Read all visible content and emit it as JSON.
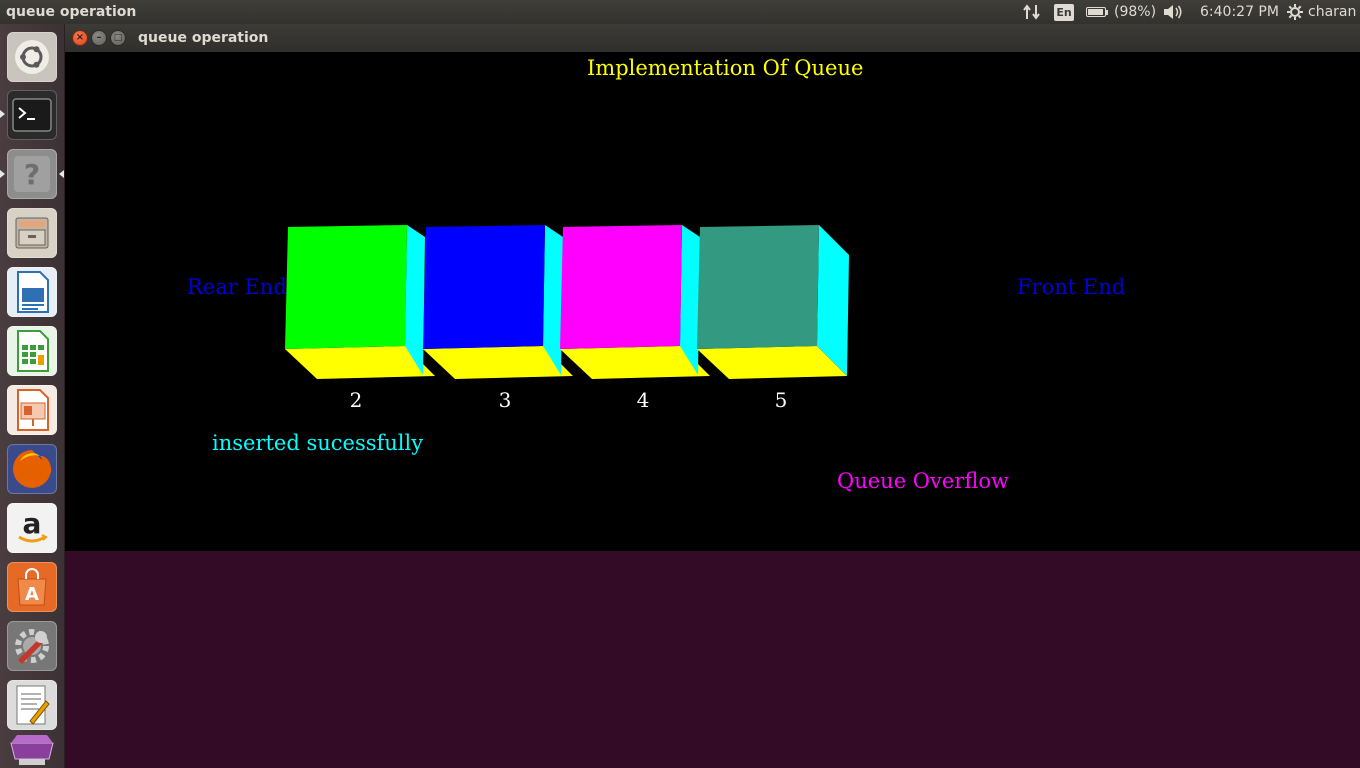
{
  "top_panel": {
    "app_title": "queue operation",
    "keyboard_layout": "En",
    "battery": "(98%)",
    "battery_level": 0.98,
    "time": "6:40:27 PM",
    "user": "charan",
    "icons": [
      "network-transfer-icon",
      "keyboard-layout-icon",
      "battery-icon",
      "volume-icon",
      "settings-gear-icon"
    ]
  },
  "launcher": {
    "items": [
      {
        "name": "ubuntu-dash",
        "icon": "ubuntu-logo-icon"
      },
      {
        "name": "terminal",
        "icon": "terminal-icon"
      },
      {
        "name": "help",
        "icon": "help-icon"
      },
      {
        "name": "files",
        "icon": "file-cabinet-icon"
      },
      {
        "name": "libreoffice-writer",
        "icon": "writer-icon"
      },
      {
        "name": "libreoffice-calc",
        "icon": "calc-icon"
      },
      {
        "name": "libreoffice-impress",
        "icon": "impress-icon"
      },
      {
        "name": "firefox",
        "icon": "firefox-icon"
      },
      {
        "name": "amazon",
        "icon": "amazon-icon"
      },
      {
        "name": "software-center",
        "icon": "shopping-bag-icon"
      },
      {
        "name": "system-settings",
        "icon": "wrench-gear-icon"
      },
      {
        "name": "text-editor",
        "icon": "text-editor-icon"
      },
      {
        "name": "workspace-switcher",
        "icon": "workspace-icon"
      }
    ],
    "colors": {
      "ubuntu": "#c9c4bd",
      "terminal": "#2b2b2b",
      "help": "#8d8d8d",
      "files": "#d8d2c6",
      "writer": "#2f6fb3",
      "calc": "#3e9d3b",
      "impress": "#d9622b",
      "firefox": "#e66000",
      "amazon": "#f2f2f2",
      "software": "#e66a26",
      "settings": "#777777",
      "editor": "#dcdcdc",
      "workspace": "#8a3f9c"
    }
  },
  "window": {
    "title": "queue operation",
    "buttons": {
      "close": "×",
      "minimize": "–",
      "maximize": "□"
    }
  },
  "canvas": {
    "heading": "Implementation Of Queue",
    "rear_label": "Rear End",
    "front_label": "Front End",
    "status_message": "inserted sucessfully",
    "overflow_message": "Queue Overflow",
    "queue_values": [
      "2",
      "3",
      "4",
      "5"
    ],
    "box_colors": [
      "#00ff00",
      "#0000ff",
      "#ff00ff",
      "#339980"
    ],
    "side_color": "#00ffff",
    "bottom_color": "#ffff00",
    "text_colors": {
      "heading": "#ffff00",
      "ends": "#0000dd",
      "status": "#00ffff",
      "overflow": "#ff00ff",
      "values": "#ffffff"
    }
  }
}
